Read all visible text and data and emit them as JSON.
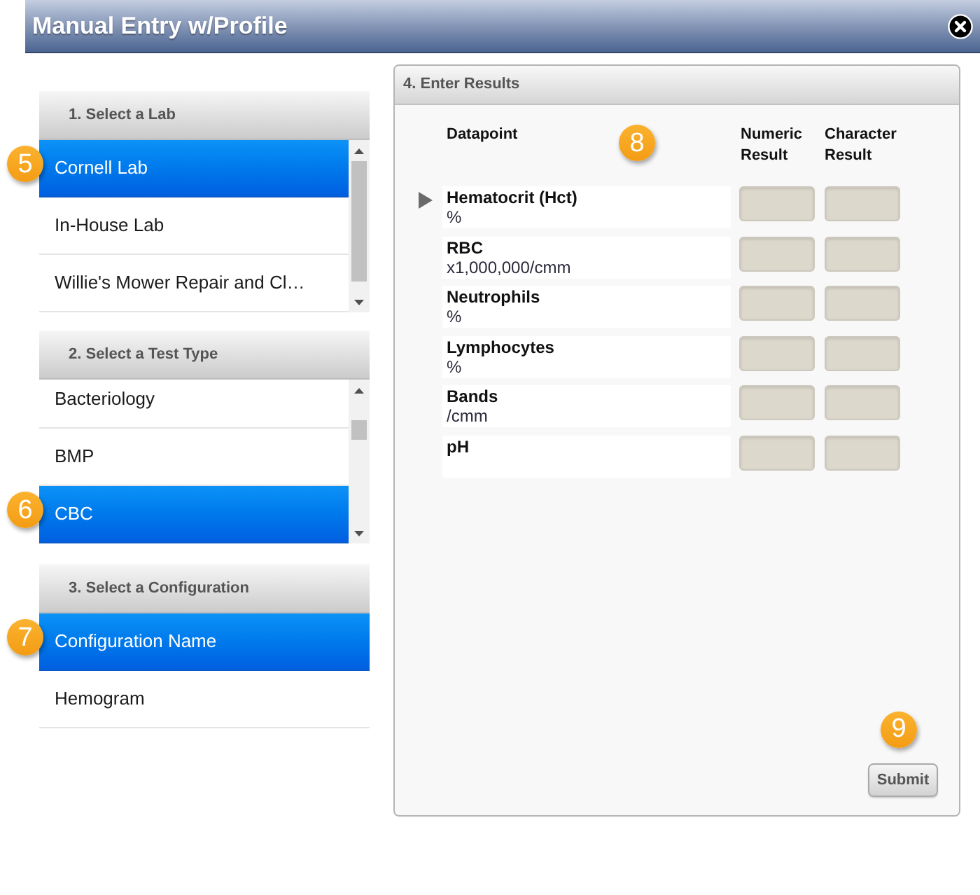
{
  "window": {
    "title": "Manual Entry w/Profile"
  },
  "sections": [
    {
      "heading": "1. Select a Lab",
      "callout": "5",
      "scrollbar": true,
      "items": [
        {
          "label": "Cornell Lab",
          "selected": true
        },
        {
          "label": "In-House Lab",
          "selected": false
        },
        {
          "label": "Willie's Mower Repair and Cl…",
          "selected": false
        }
      ]
    },
    {
      "heading": "2. Select a Test Type",
      "callout": "6",
      "scrollbar": true,
      "items": [
        {
          "label": "Bacteriology",
          "selected": false
        },
        {
          "label": "BMP",
          "selected": false
        },
        {
          "label": "CBC",
          "selected": true
        }
      ]
    },
    {
      "heading": "3. Select a Configuration",
      "callout": "7",
      "scrollbar": false,
      "items": [
        {
          "label": "Configuration Name",
          "selected": true
        },
        {
          "label": "Hemogram",
          "selected": false
        }
      ]
    }
  ],
  "results": {
    "heading": "4. Enter Results",
    "callout": "8",
    "columns": [
      "Datapoint",
      "Numeric Result",
      "Character Result"
    ],
    "rows": [
      {
        "name": "Hematocrit (Hct)",
        "unit": "%",
        "current": true
      },
      {
        "name": "RBC",
        "unit": "x1,000,000/cmm",
        "current": false
      },
      {
        "name": "Neutrophils",
        "unit": "%",
        "current": false
      },
      {
        "name": "Lymphocytes",
        "unit": "%",
        "current": false
      },
      {
        "name": "Bands",
        "unit": "/cmm",
        "current": false
      },
      {
        "name": "pH",
        "current": false
      }
    ],
    "submit": {
      "label": "Submit",
      "callout": "9"
    }
  }
}
